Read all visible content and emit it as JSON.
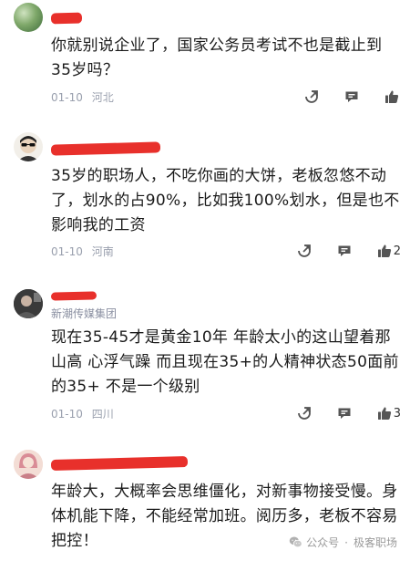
{
  "comments": [
    {
      "text": "你就别说企业了，国家公务员考试不也是截止到35岁吗？",
      "date": "01-10",
      "location": "河北",
      "like_count": ""
    },
    {
      "text": "35岁的职场人，不吃你画的大饼，老板忽悠不动了，划水的占90%，比如我100%划水，但是也不影响我的工资",
      "date": "01-10",
      "location": "河南",
      "like_count": "2"
    },
    {
      "author_sub": "新潮传媒集团",
      "text": "现在35-45才是黄金10年  年龄太小的这山望着那山高  心浮气躁  而且现在35+的人精神状态50面前的35+ 不是一个级别",
      "date": "01-10",
      "location": "四川",
      "like_count": "3"
    },
    {
      "text": "年龄大，大概率会思维僵化，对新事物接受慢。身体机能下降，不能经常加班。阅历多，老板不容易把控！"
    }
  ],
  "watermark": {
    "source": "公众号",
    "account": "极客职场"
  },
  "icons": [
    "share-icon",
    "comment-icon",
    "like-icon",
    "wechat-icon"
  ],
  "colors": {
    "redaction": "#e8302b",
    "meta": "#9aa0ae"
  }
}
